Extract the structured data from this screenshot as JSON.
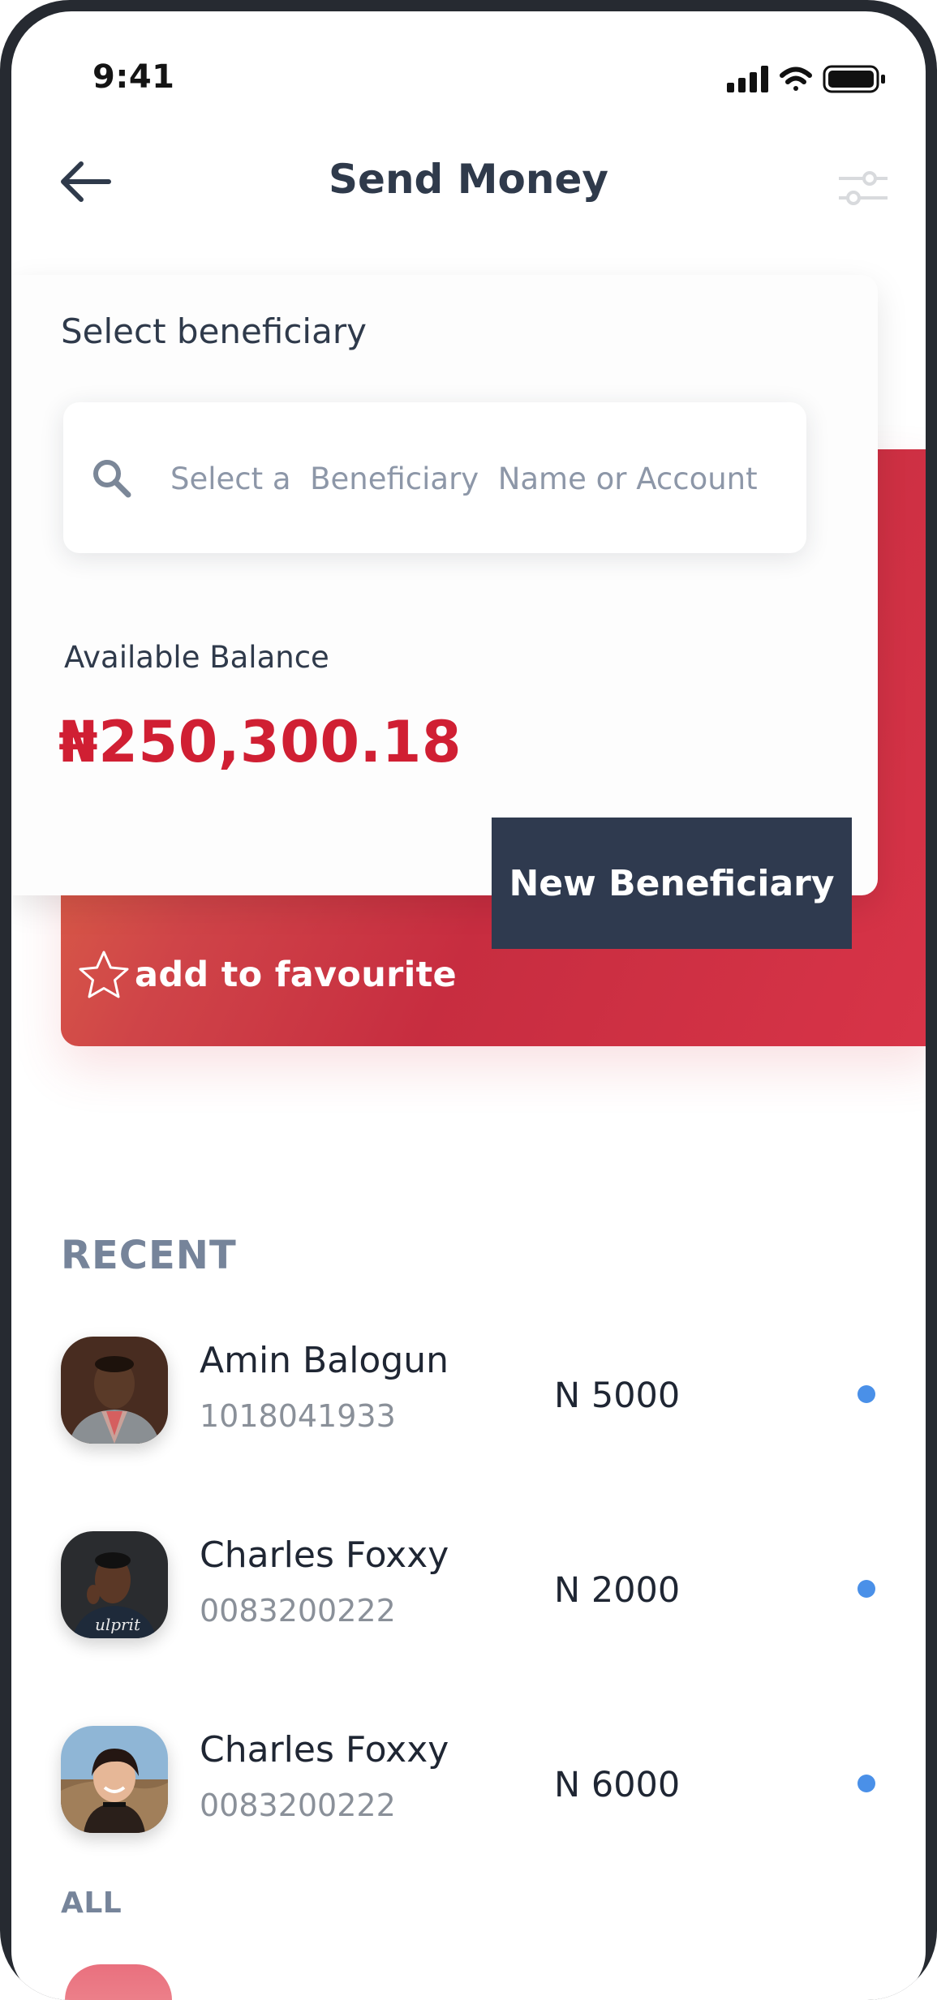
{
  "status_bar": {
    "time": "9:41"
  },
  "header": {
    "title": "Send Money"
  },
  "beneficiary": {
    "label": "Select beneficiary",
    "search_placeholder": "Select a  Beneficiary  Name or Account"
  },
  "balance": {
    "label": "Available Balance",
    "amount": "₦250,300.18"
  },
  "actions": {
    "new_beneficiary": "New Beneficiary",
    "add_favourite": "add to favourite"
  },
  "recent": {
    "heading": "RECENT",
    "items": [
      {
        "name": "Amin Balogun",
        "account": "1018041933",
        "amount": "N 5000"
      },
      {
        "name": "Charles Foxxy",
        "account": "0083200222",
        "amount": "N 2000"
      },
      {
        "name": "Charles Foxxy",
        "account": "0083200222",
        "amount": "N 6000"
      }
    ]
  },
  "all": {
    "heading": "ALL"
  },
  "icons": {
    "back": "arrow-left-icon",
    "filter": "sliders-icon",
    "search": "search-icon",
    "favourite": "star-outline-icon",
    "status": [
      "signal-icon",
      "wifi-icon",
      "battery-icon"
    ]
  },
  "colors": {
    "primary_text": "#2f3a4b",
    "accent_red": "#d01f33",
    "dark_button": "#2f3a4f",
    "muted": "#76849a",
    "unread_dot": "#4a90e8"
  }
}
